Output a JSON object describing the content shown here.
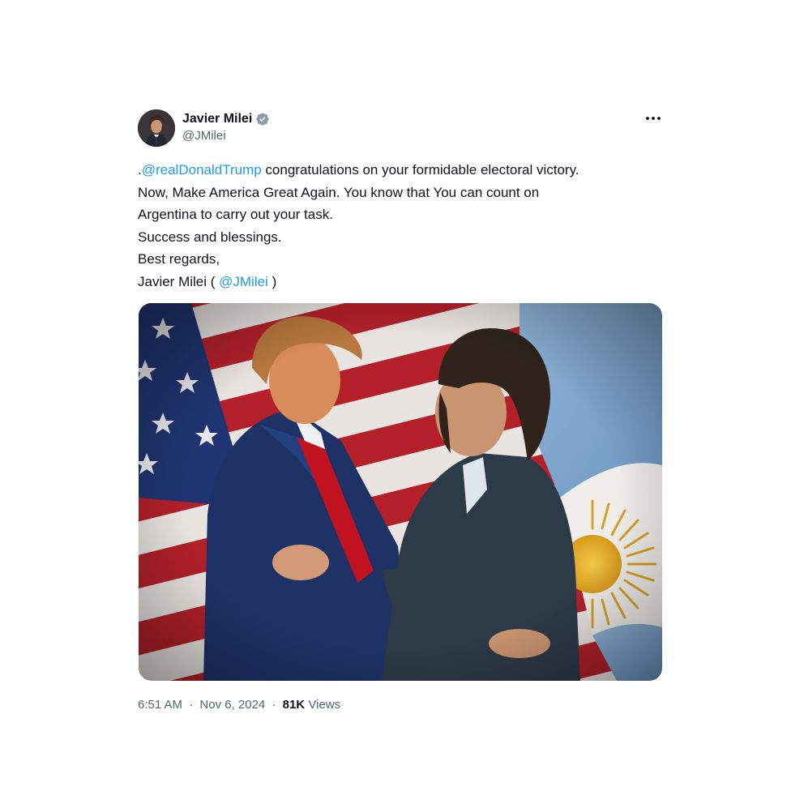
{
  "author": {
    "display_name": "Javier Milei",
    "handle": "@JMilei",
    "verified": true,
    "verified_color": "#1d9bf0"
  },
  "tweet": {
    "lines": [
      [
        {
          "type": "text",
          "value": "."
        },
        {
          "type": "mention",
          "value": "@realDonaldTrump"
        },
        {
          "type": "text",
          "value": " congratulations on your formidable electoral victory."
        }
      ],
      [
        {
          "type": "text",
          "value": "Now, Make America Great Again. You know that You can count on"
        }
      ],
      [
        {
          "type": "text",
          "value": "Argentina to carry out your task."
        }
      ],
      [
        {
          "type": "text",
          "value": "Success and blessings."
        }
      ],
      [
        {
          "type": "text",
          "value": "Best regards,"
        }
      ],
      [
        {
          "type": "text",
          "value": "Javier Milei ( "
        },
        {
          "type": "mention",
          "value": "@JMilei"
        },
        {
          "type": "text",
          "value": " )"
        }
      ]
    ],
    "mention_color": "#1d9bf0"
  },
  "meta": {
    "time": "6:51 AM",
    "date": "Nov 6, 2024",
    "views_count": "81K",
    "views_label": "Views",
    "separator": "·"
  },
  "icons": {
    "more": "more-horizontal-icon",
    "verified": "verified-badge-icon"
  }
}
